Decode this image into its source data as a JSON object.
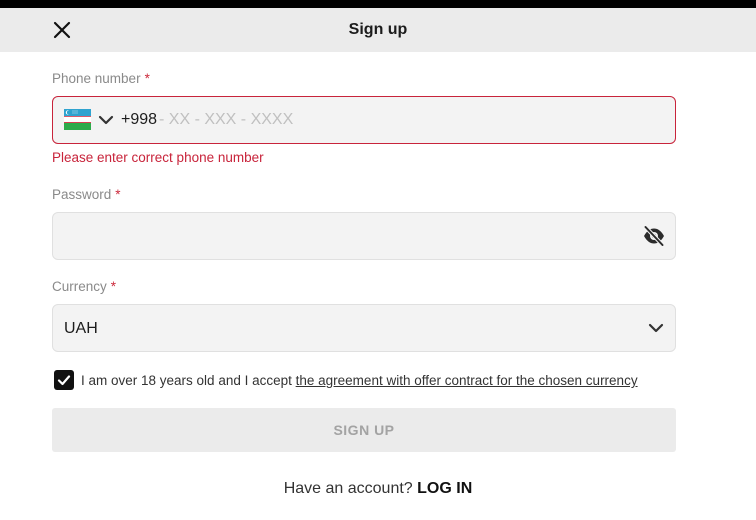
{
  "header": {
    "title": "Sign up",
    "close_icon": "close-icon"
  },
  "phone": {
    "label": "Phone number",
    "required_mark": "*",
    "country_flag": "uzbekistan-flag-icon",
    "dial_code": "+998",
    "value": "",
    "placeholder": "- XX - XXX - XXXX",
    "error": "Please enter correct phone number"
  },
  "password": {
    "label": "Password",
    "required_mark": "*",
    "value": "",
    "toggle_icon": "eye-off-icon"
  },
  "currency": {
    "label": "Currency",
    "required_mark": "*",
    "selected": "UAH"
  },
  "agreement": {
    "checked": true,
    "text": "I am over 18 years old and I accept",
    "link": "the agreement with offer contract for the chosen currency"
  },
  "signup_button": {
    "label": "SIGN UP"
  },
  "footer": {
    "prompt": "Have an account?",
    "login_label": "LOG IN"
  },
  "colors": {
    "error": "#c8243b",
    "field_bg": "#f3f3f3",
    "header_bg": "#ebebeb"
  }
}
